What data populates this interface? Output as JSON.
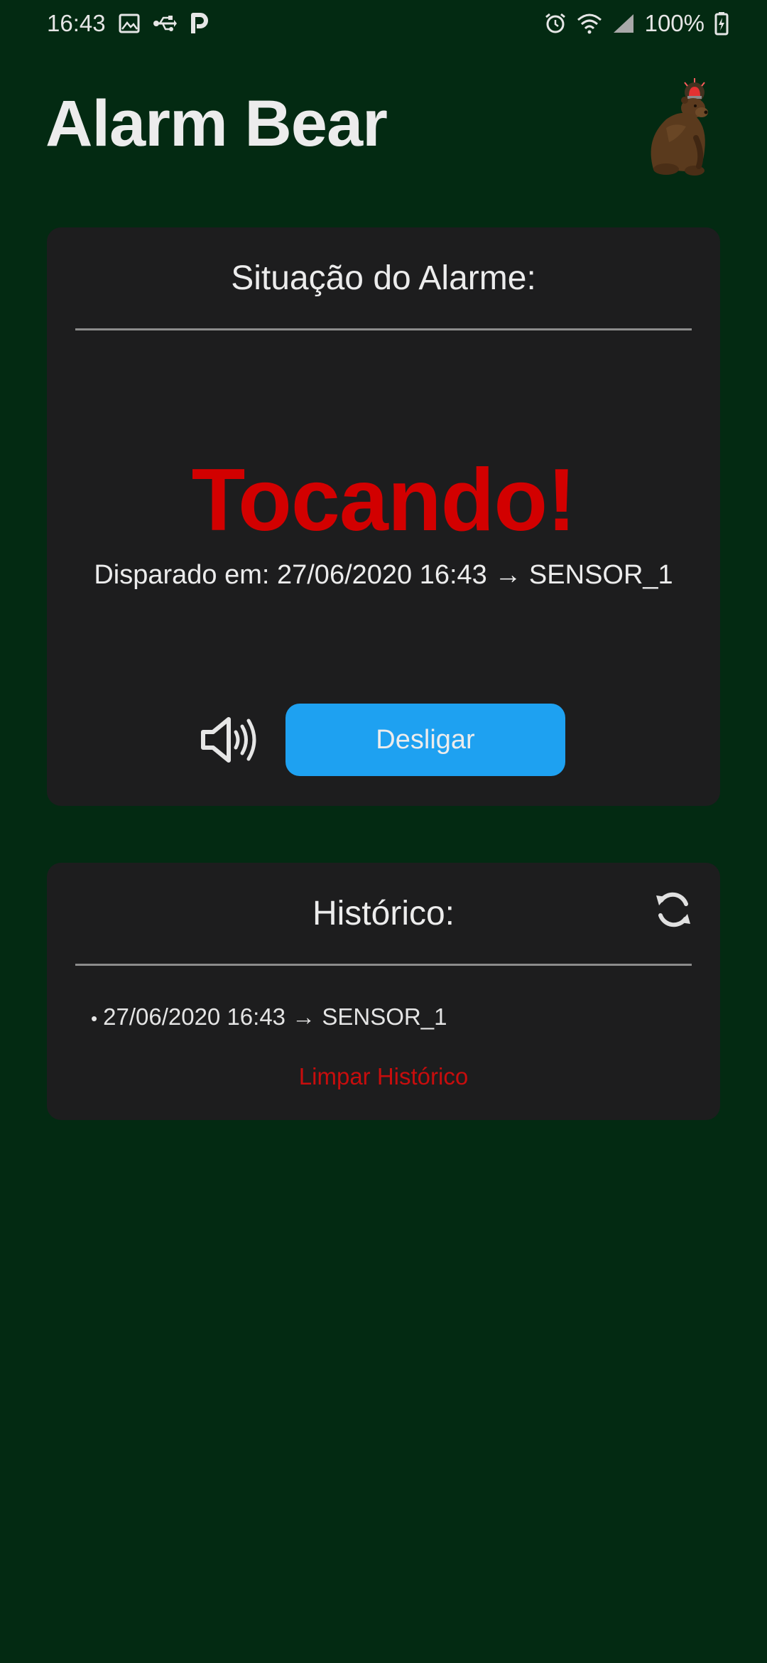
{
  "status_bar": {
    "time": "16:43",
    "left_icons": [
      "image-icon",
      "usb-icon",
      "parking-icon"
    ],
    "right_icons": [
      "alarm-clock-icon",
      "wifi-icon",
      "signal-icon",
      "battery-charging-icon"
    ],
    "battery": "100%"
  },
  "app": {
    "title": "Alarm Bear",
    "logo_icon": "bear-with-siren-icon"
  },
  "alarm": {
    "heading": "Situação do Alarme:",
    "state": "Tocando!",
    "state_color": "#d20000",
    "triggered_text": "Disparado em: 27/06/2020 16:43 → SENSOR_1",
    "sound_icon": "speaker-volume-icon",
    "off_button_label": "Desligar",
    "button_color": "#1ea1f1"
  },
  "history": {
    "heading": "Histórico:",
    "refresh_icon": "refresh-icon",
    "items": [
      {
        "text": "27/06/2020 16:43 → SENSOR_1"
      }
    ],
    "clear_label": "Limpar Histórico",
    "clear_color": "#c70d0d"
  },
  "colors": {
    "background": "#032a12",
    "card": "#1d1d1e",
    "text": "#ececec"
  }
}
